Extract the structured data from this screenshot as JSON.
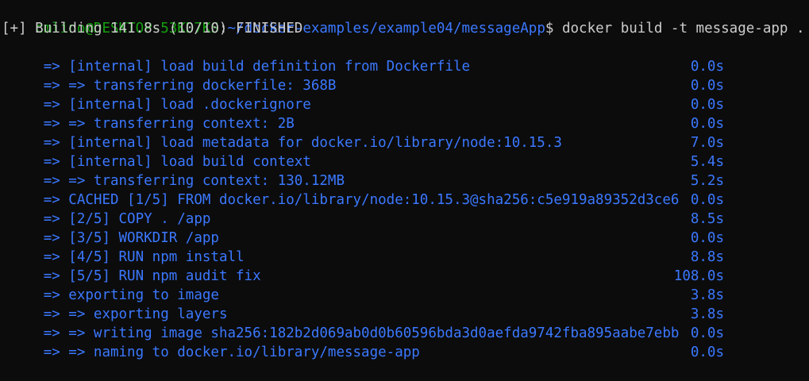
{
  "prompt": {
    "user_host": "cmlino@DESKTOP-53KD7KS",
    "separator": ":",
    "path": "~/docker-examples/example04/messageApp",
    "symbol": "$",
    "command": " docker build -t message-app ."
  },
  "status": "[+] Building 141.8s (10/10) FINISHED",
  "colors": {
    "background": "#0c0c0c",
    "prompt_user": "#13a10e",
    "prompt_path": "#3b78ff",
    "text": "#cccccc",
    "build_steps": "#3b78ff"
  },
  "steps": [
    {
      "text": " => [internal] load build definition from Dockerfile",
      "time": "0.0s"
    },
    {
      "text": " => => transferring dockerfile: 368B",
      "time": "0.0s"
    },
    {
      "text": " => [internal] load .dockerignore",
      "time": "0.0s"
    },
    {
      "text": " => => transferring context: 2B",
      "time": "0.0s"
    },
    {
      "text": " => [internal] load metadata for docker.io/library/node:10.15.3",
      "time": "7.0s"
    },
    {
      "text": " => [internal] load build context",
      "time": "5.4s"
    },
    {
      "text": " => => transferring context: 130.12MB",
      "time": "5.2s"
    },
    {
      "text": " => CACHED [1/5] FROM docker.io/library/node:10.15.3@sha256:c5e919a89352d3ce6",
      "time": "0.0s"
    },
    {
      "text": " => [2/5] COPY . /app",
      "time": "8.5s"
    },
    {
      "text": " => [3/5] WORKDIR /app",
      "time": "0.0s"
    },
    {
      "text": " => [4/5] RUN npm install",
      "time": "8.8s"
    },
    {
      "text": " => [5/5] RUN npm audit fix",
      "time": "108.0s"
    },
    {
      "text": " => exporting to image",
      "time": "3.8s"
    },
    {
      "text": " => => exporting layers",
      "time": "3.8s"
    },
    {
      "text": " => => writing image sha256:182b2d069ab0d0b60596bda3d0aefda9742fba895aabe7ebb",
      "time": "0.0s"
    },
    {
      "text": " => => naming to docker.io/library/message-app",
      "time": "0.0s"
    }
  ]
}
